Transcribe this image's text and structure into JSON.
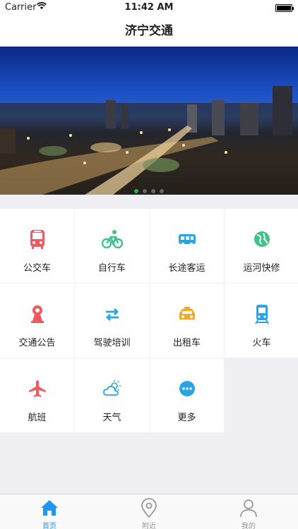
{
  "status_bar": {
    "carrier": "Carrier",
    "time": "11:42 AM"
  },
  "nav": {
    "title": "济宁交通"
  },
  "banner": {
    "dot_count": 4,
    "active_dot": 0
  },
  "grid": {
    "items": [
      {
        "label": "公交车",
        "icon": "bus-icon",
        "color": "#f0595e"
      },
      {
        "label": "自行车",
        "icon": "bicycle-icon",
        "color": "#3ec38a"
      },
      {
        "label": "长途客运",
        "icon": "coach-icon",
        "color": "#2ba4e6"
      },
      {
        "label": "运河快修",
        "icon": "globe-icon",
        "color": "#3ec38a"
      },
      {
        "label": "交通公告",
        "icon": "traffic-notice-icon",
        "color": "#f0595e"
      },
      {
        "label": "驾驶培训",
        "icon": "swap-arrows-icon",
        "color": "#2ba4e6"
      },
      {
        "label": "出租车",
        "icon": "taxi-icon",
        "color": "#f5a623"
      },
      {
        "label": "火车",
        "icon": "train-icon",
        "color": "#2ba4e6"
      },
      {
        "label": "航班",
        "icon": "airplane-icon",
        "color": "#f0595e"
      },
      {
        "label": "天气",
        "icon": "weather-icon",
        "color": "#2ba4e6"
      },
      {
        "label": "更多",
        "icon": "more-icon",
        "color": "#2ba4e6"
      }
    ]
  },
  "tab_bar": {
    "active_color": "#2196f3",
    "tabs": [
      {
        "label": "首页",
        "icon": "home-icon"
      },
      {
        "label": "附近",
        "icon": "location-pin-icon"
      },
      {
        "label": "我的",
        "icon": "person-icon"
      }
    ]
  }
}
